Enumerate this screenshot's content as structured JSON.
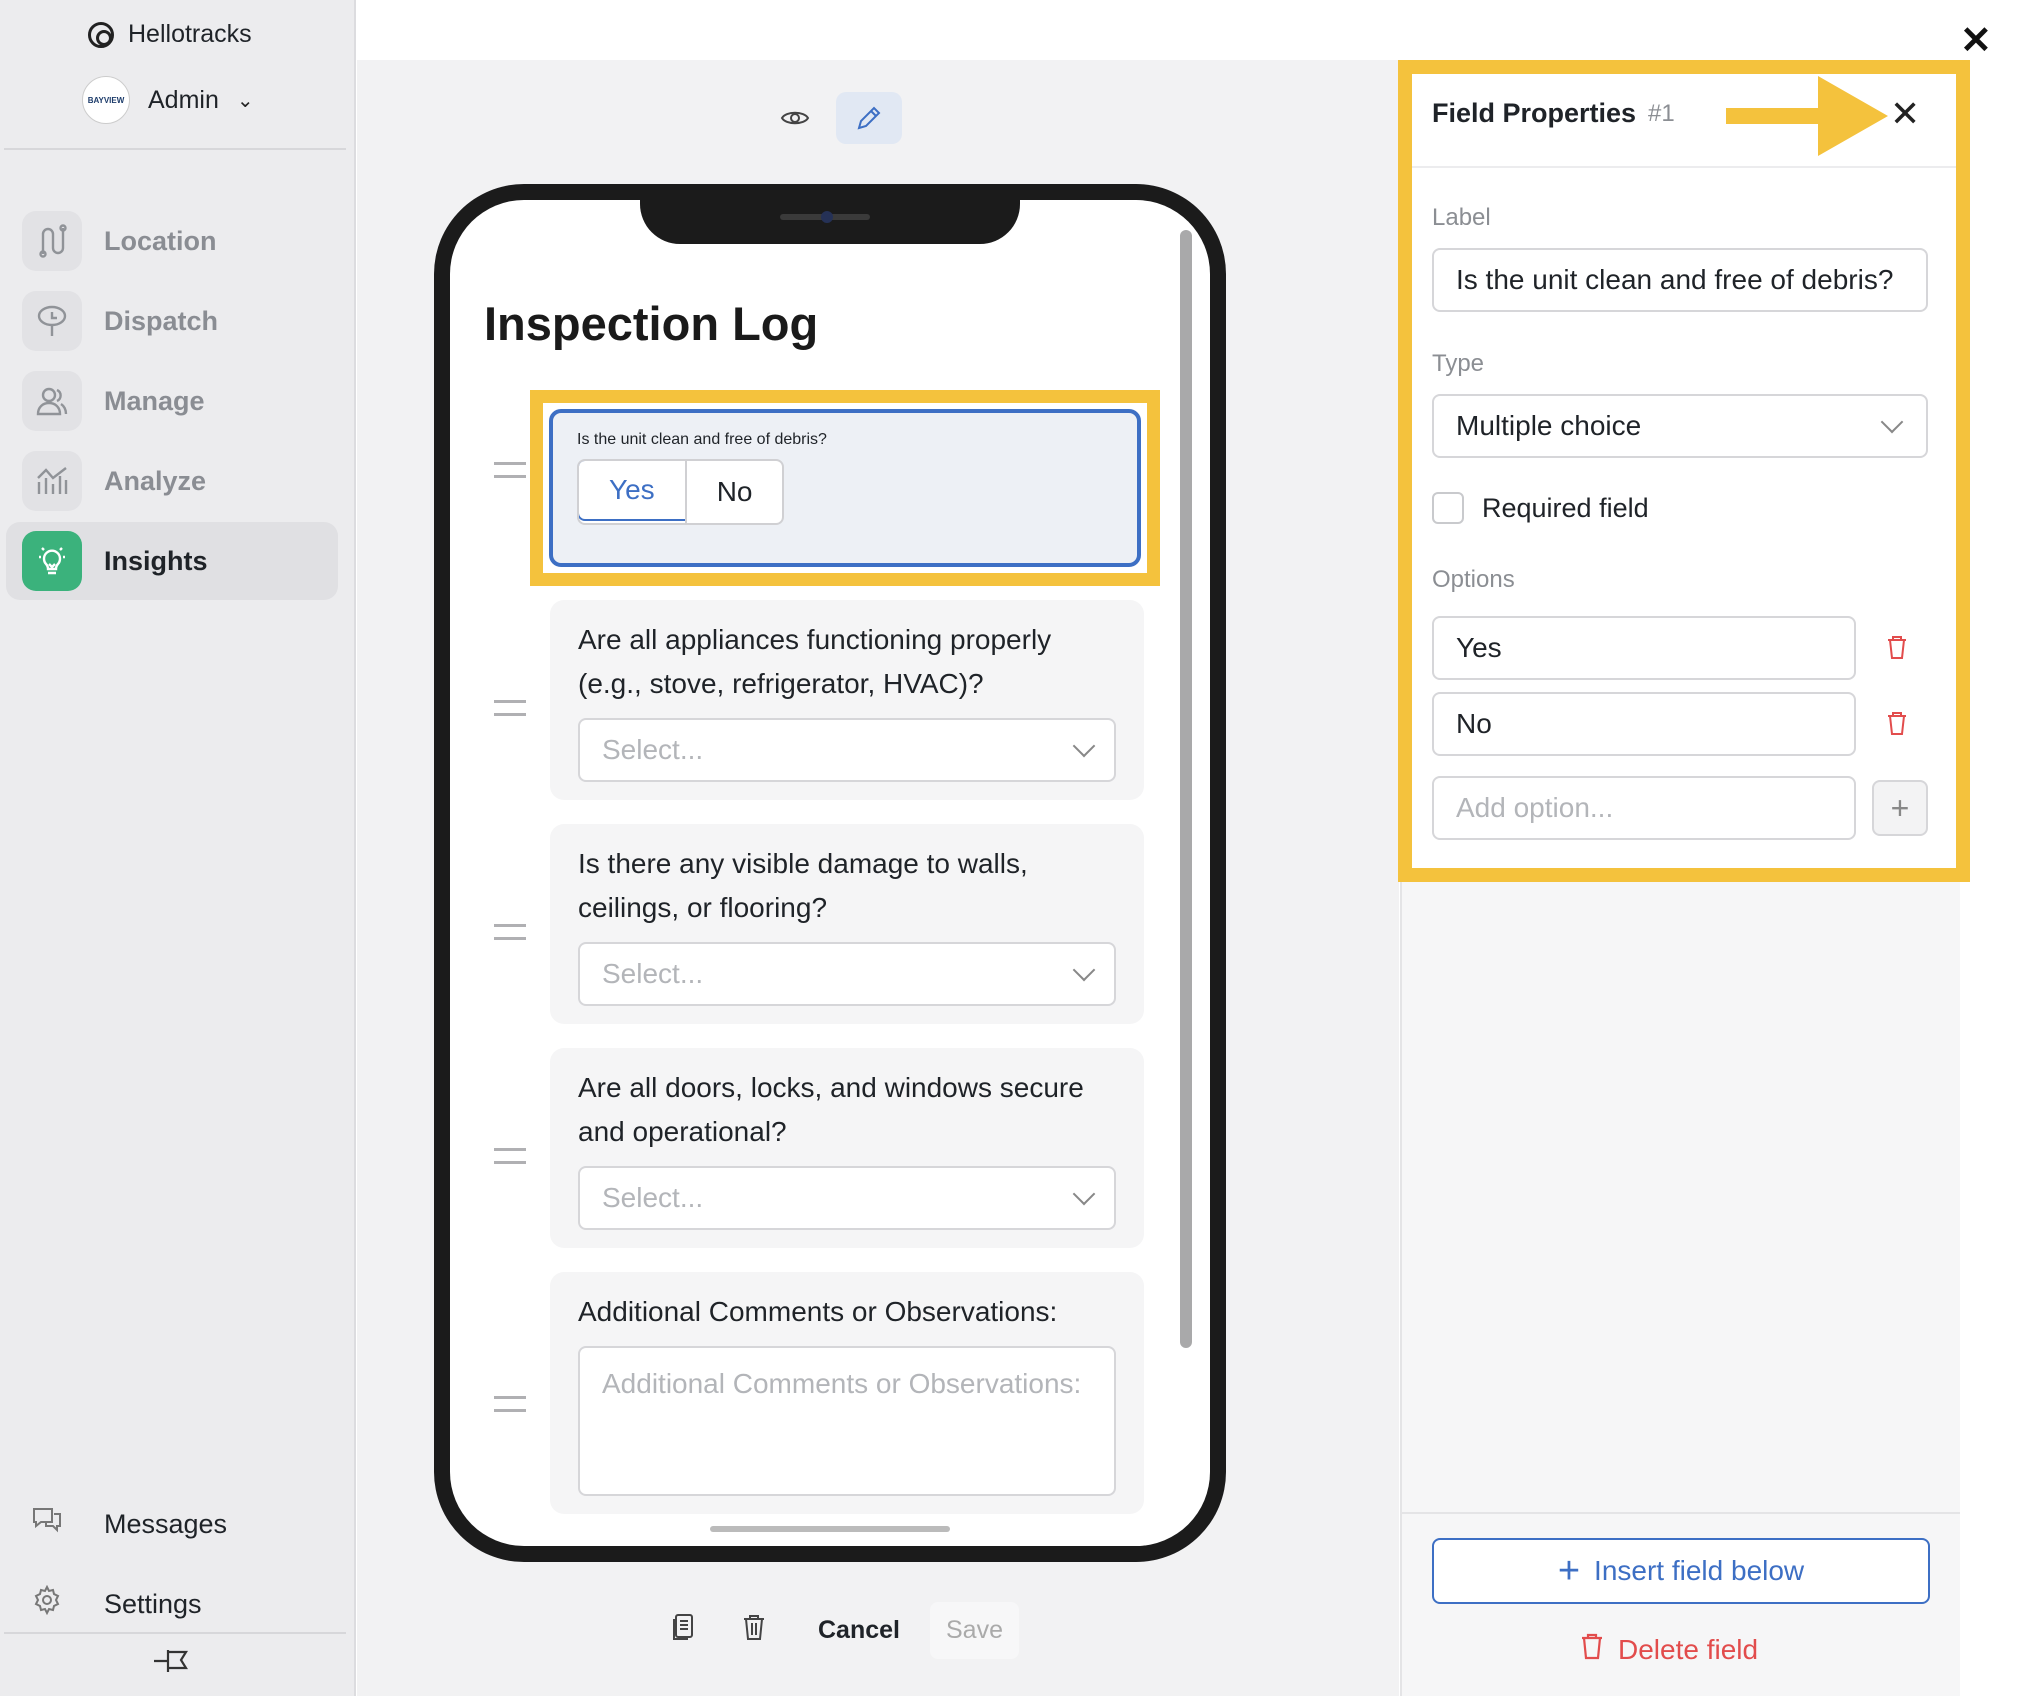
{
  "sidebar": {
    "org_name": "Hellotracks",
    "user": "Admin",
    "avatar_text": "BAYVIEW",
    "items": [
      {
        "label": "Location",
        "icon": "location-route-icon"
      },
      {
        "label": "Dispatch",
        "icon": "dispatch-sign-icon"
      },
      {
        "label": "Manage",
        "icon": "manage-users-icon"
      },
      {
        "label": "Analyze",
        "icon": "analyze-chart-icon"
      },
      {
        "label": "Insights",
        "icon": "insights-lightbulb-icon",
        "active": true
      }
    ],
    "bottom": [
      {
        "label": "Messages",
        "icon": "messages-icon"
      },
      {
        "label": "Settings",
        "icon": "gear-icon"
      }
    ]
  },
  "form": {
    "title": "Inspection Log",
    "fields": [
      {
        "question": "Is the unit clean and free of debris?",
        "options": [
          "Yes",
          "No"
        ],
        "selected": "Yes"
      },
      {
        "question": "Are all appliances functioning properly (e.g., stove, refrigerator, HVAC)?",
        "placeholder": "Select..."
      },
      {
        "question": "Is there any visible damage to walls, ceilings, or flooring?",
        "placeholder": "Select..."
      },
      {
        "question": "Are all doors, locks, and windows secure and operational?",
        "placeholder": "Select..."
      },
      {
        "question": "Additional Comments or Observations:",
        "placeholder": "Additional Comments or Observations:"
      }
    ]
  },
  "actions": {
    "cancel": "Cancel",
    "save": "Save"
  },
  "properties": {
    "title": "Field Properties",
    "number": "#1",
    "label_heading": "Label",
    "label_value": "Is the unit clean and free of debris?",
    "type_heading": "Type",
    "type_value": "Multiple choice",
    "required_label": "Required field",
    "options_heading": "Options",
    "options": [
      "Yes",
      "No"
    ],
    "add_option_placeholder": "Add option...",
    "insert_label": "Insert field below",
    "delete_label": "Delete field"
  },
  "colors": {
    "highlight": "#f4c23d",
    "accent": "#3d6fc4",
    "danger": "#e24c4c",
    "insights": "#3bb27c"
  }
}
